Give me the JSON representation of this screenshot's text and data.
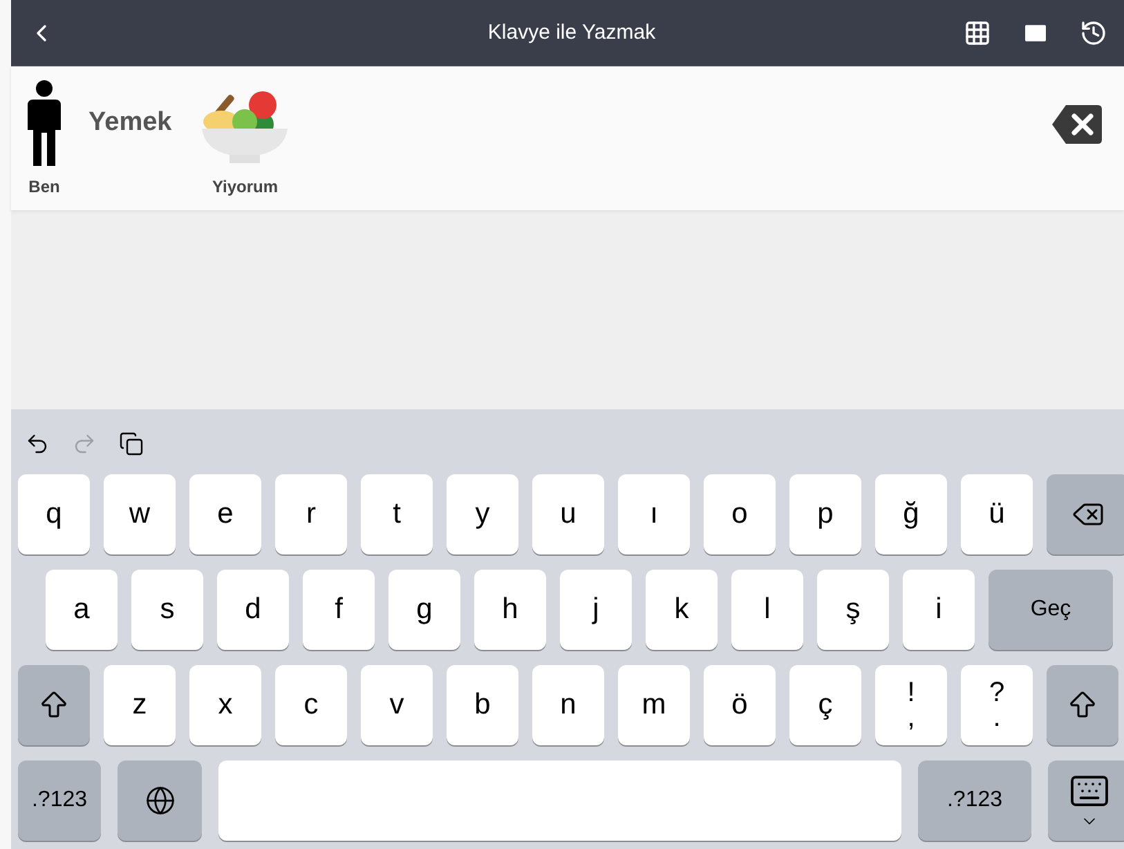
{
  "header": {
    "title": "Klavye ile Yazmak"
  },
  "sentence": [
    {
      "kind": "person",
      "label": "Ben"
    },
    {
      "kind": "word",
      "label": "Yemek"
    },
    {
      "kind": "food",
      "label": "Yiyorum"
    }
  ],
  "keyboard": {
    "toolbar": [
      {
        "kind": "undo",
        "disabled": false
      },
      {
        "kind": "redo",
        "disabled": true
      },
      {
        "kind": "paste",
        "disabled": false
      }
    ],
    "rows": [
      {
        "keys": [
          {
            "kind": "letter",
            "label": "q"
          },
          {
            "kind": "letter",
            "label": "w"
          },
          {
            "kind": "letter",
            "label": "e"
          },
          {
            "kind": "letter",
            "label": "r"
          },
          {
            "kind": "letter",
            "label": "t"
          },
          {
            "kind": "letter",
            "label": "y"
          },
          {
            "kind": "letter",
            "label": "u"
          },
          {
            "kind": "letter",
            "label": "ı"
          },
          {
            "kind": "letter",
            "label": "o"
          },
          {
            "kind": "letter",
            "label": "p"
          },
          {
            "kind": "letter",
            "label": "ğ"
          },
          {
            "kind": "letter",
            "label": "ü"
          },
          {
            "kind": "backspace"
          }
        ]
      },
      {
        "keys": [
          {
            "kind": "letter",
            "label": "a"
          },
          {
            "kind": "letter",
            "label": "s"
          },
          {
            "kind": "letter",
            "label": "d"
          },
          {
            "kind": "letter",
            "label": "f"
          },
          {
            "kind": "letter",
            "label": "g"
          },
          {
            "kind": "letter",
            "label": "h"
          },
          {
            "kind": "letter",
            "label": "j"
          },
          {
            "kind": "letter",
            "label": "k"
          },
          {
            "kind": "letter",
            "label": "l"
          },
          {
            "kind": "letter",
            "label": "ş"
          },
          {
            "kind": "letter",
            "label": "i"
          },
          {
            "kind": "action",
            "label": "Geç"
          }
        ]
      },
      {
        "keys": [
          {
            "kind": "shift"
          },
          {
            "kind": "letter",
            "label": "z"
          },
          {
            "kind": "letter",
            "label": "x"
          },
          {
            "kind": "letter",
            "label": "c"
          },
          {
            "kind": "letter",
            "label": "v"
          },
          {
            "kind": "letter",
            "label": "b"
          },
          {
            "kind": "letter",
            "label": "n"
          },
          {
            "kind": "letter",
            "label": "m"
          },
          {
            "kind": "letter",
            "label": "ö"
          },
          {
            "kind": "letter",
            "label": "ç"
          },
          {
            "kind": "dual",
            "label": "!",
            "sublabel": ","
          },
          {
            "kind": "dual",
            "label": "?",
            "sublabel": "."
          },
          {
            "kind": "shift"
          }
        ]
      },
      {
        "keys": [
          {
            "kind": "numbers",
            "label": ".?123"
          },
          {
            "kind": "globe"
          },
          {
            "kind": "space"
          },
          {
            "kind": "numbers-wide",
            "label": ".?123"
          },
          {
            "kind": "hide"
          }
        ]
      }
    ]
  }
}
